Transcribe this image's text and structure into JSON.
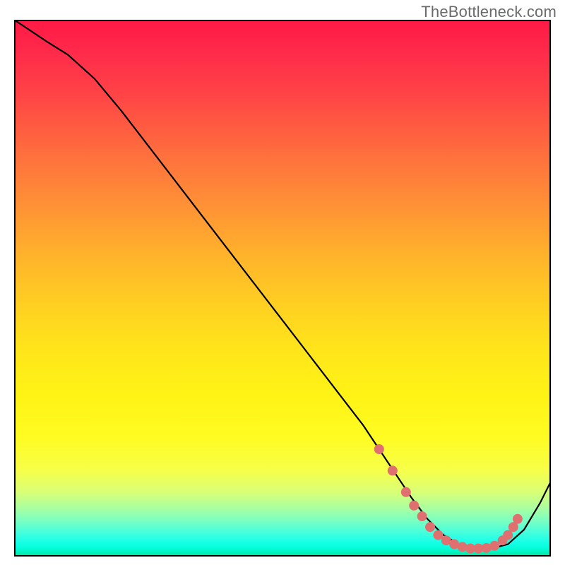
{
  "watermark": "TheBottleneck.com",
  "chart_data": {
    "type": "line",
    "title": "",
    "xlabel": "",
    "ylabel": "",
    "xlim": [
      0,
      100
    ],
    "ylim": [
      0,
      100
    ],
    "background_gradient": {
      "top": "#ff1945",
      "bottom": "#00df96"
    },
    "series": [
      {
        "name": "bottleneck-curve",
        "color": "#000000",
        "x": [
          0,
          3,
          6,
          10,
          15,
          20,
          25,
          30,
          35,
          40,
          45,
          50,
          55,
          60,
          65,
          68,
          71,
          74,
          77,
          80,
          83,
          86,
          89,
          92,
          95,
          98,
          100
        ],
        "y": [
          100,
          98,
          96,
          93.5,
          89,
          83,
          76.5,
          70,
          63.5,
          57,
          50.5,
          44,
          37.5,
          31,
          24.5,
          20,
          15.5,
          11,
          7,
          4,
          2.2,
          1.5,
          1.5,
          2.3,
          5,
          10,
          14
        ]
      }
    ],
    "markers": [
      {
        "name": "highlight-dots",
        "color": "#e07070",
        "radius": 7,
        "points": [
          {
            "x": 68,
            "y": 20
          },
          {
            "x": 70.5,
            "y": 16
          },
          {
            "x": 73,
            "y": 12
          },
          {
            "x": 74.5,
            "y": 9.5
          },
          {
            "x": 76,
            "y": 7.5
          },
          {
            "x": 77.5,
            "y": 5.5
          },
          {
            "x": 79,
            "y": 4
          },
          {
            "x": 80.5,
            "y": 3
          },
          {
            "x": 82,
            "y": 2.3
          },
          {
            "x": 83.5,
            "y": 1.8
          },
          {
            "x": 85,
            "y": 1.5
          },
          {
            "x": 86.5,
            "y": 1.5
          },
          {
            "x": 88,
            "y": 1.6
          },
          {
            "x": 89.5,
            "y": 2
          },
          {
            "x": 91,
            "y": 3
          },
          {
            "x": 92,
            "y": 4
          },
          {
            "x": 93,
            "y": 5.5
          },
          {
            "x": 93.8,
            "y": 7
          }
        ]
      }
    ]
  }
}
